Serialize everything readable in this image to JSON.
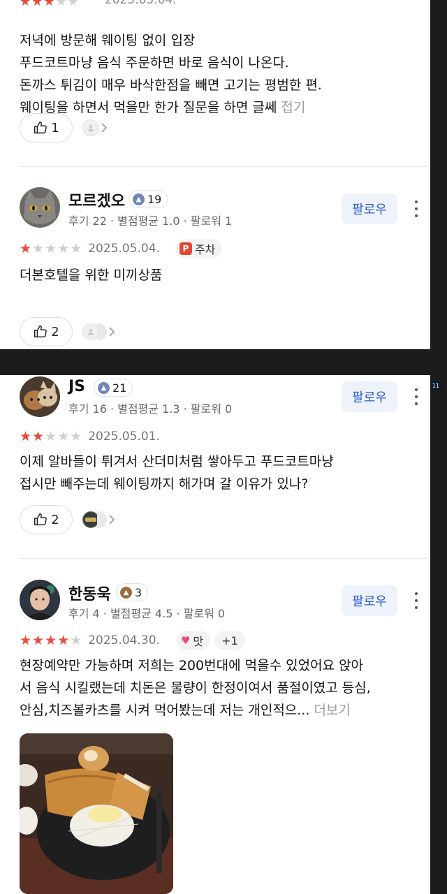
{
  "review_top": {
    "stars_filled": 3,
    "date_partial": "2025.05.04.",
    "text": "저녁에 방문해 웨이팅 없이 입장\n푸드코트마냥 음식 주문하면 바로 음식이 나온다.\n돈까스 튀김이 매우 바삭한점을 빼면 고기는 평범한 편.\n웨이팅을 하면서 먹을만 한가 질문을 하면 글쎄 ",
    "fold_label": "접기",
    "likes": "1"
  },
  "reviews": [
    {
      "user": "모르겠오",
      "level": "19",
      "meta": "후기 22 · 별점평균 1.0 · 팔로워 1",
      "follow_label": "팔로우",
      "stars_filled": 1,
      "date": "2025.05.04.",
      "tag": "주차",
      "tag_icon": "P",
      "text": "더본호텔을 위한 미끼상품",
      "likes": "2"
    },
    {
      "user": "JS",
      "level": "21",
      "meta": "후기 16 · 별점평균 1.3 · 팔로워 0",
      "follow_label": "팔로우",
      "stars_filled": 2,
      "date": "2025.05.01.",
      "text": "이제 알바들이 튀겨서 산더미처럼 쌓아두고 푸드코트마냥\n접시만 빼주는데 웨이팅까지 해가며 갈 이유가 있나?",
      "likes": "2"
    },
    {
      "user": "한동욱",
      "level": "3",
      "meta": "후기 4 · 별점평균 4.5 · 팔로워 0",
      "follow_label": "팔로우",
      "stars_filled": 4,
      "date": "2025.04.30.",
      "tag": "맛",
      "tag_extra": "+1",
      "text": "현장예약만 가능하며 저희는 200번대에 먹을수 있었어요 앉아\n서 음식 시킬랬는데 치돈은 물량이 한정이여서 품절이였고 등심,\n안심,치즈볼카츠를 시켜 먹어봤는데 저는 개인적으... ",
      "more_label": "더보기"
    }
  ],
  "corner_badge": "11",
  "colors": {
    "star": "#ea4a3c",
    "follow_text": "#2b5fd0",
    "follow_bg": "#eef2fb",
    "separator": "#1c1c1c"
  }
}
